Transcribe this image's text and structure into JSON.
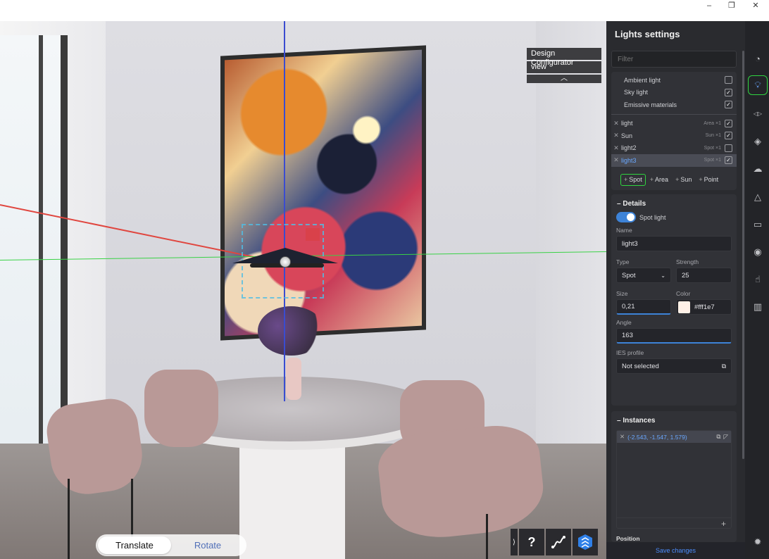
{
  "window": {
    "minimize": "–",
    "restore": "❐",
    "close": "✕"
  },
  "viewport": {
    "labels": [
      "Design Configurator",
      "view"
    ],
    "collapse": "︿",
    "mode": {
      "translate": "Translate",
      "rotate": "Rotate",
      "active": "translate"
    },
    "tools": {
      "expand": "⟩",
      "help": "?",
      "path": "path-icon",
      "logo": "logo-icon"
    }
  },
  "panel": {
    "title": "Lights settings",
    "filter_placeholder": "Filter",
    "env": [
      {
        "label": "Ambient light",
        "checked": false
      },
      {
        "label": "Sky light",
        "checked": true
      },
      {
        "label": "Emissive materials",
        "checked": true
      }
    ],
    "lights": [
      {
        "name": "light",
        "type": "Area ×1",
        "checked": true,
        "selected": false
      },
      {
        "name": "Sun",
        "type": "Sun ×1",
        "checked": true,
        "selected": false
      },
      {
        "name": "light2",
        "type": "Spot ×1",
        "checked": false,
        "selected": false
      },
      {
        "name": "light3",
        "type": "Spot ×1",
        "checked": true,
        "selected": true
      }
    ],
    "add": [
      "Spot",
      "Area",
      "Sun",
      "Point"
    ],
    "details": {
      "header": "Details",
      "spot_label": "Spot light",
      "name_label": "Name",
      "name": "light3",
      "type_label": "Type",
      "type": "Spot",
      "strength_label": "Strength",
      "strength": "25",
      "size_label": "Size",
      "size": "0,21",
      "color_label": "Color",
      "color": "#fff1e7",
      "angle_label": "Angle",
      "angle": "163",
      "ies_label": "IES profile",
      "ies": "Not selected"
    },
    "instances": {
      "header": "Instances",
      "item": "(-2.543, -1.547, 1.579)"
    },
    "position_label": "Position",
    "save": "Save changes"
  },
  "iconbar": [
    "timer-icon",
    "bulb-icon",
    "mirror-icon",
    "texture-icon",
    "cloud-icon",
    "pyramid-icon",
    "camera-icon",
    "eye-icon",
    "touch-icon",
    "map-icon",
    "settings-icon"
  ],
  "colors": {
    "accent": "#4c8eff",
    "highlight": "#30d440",
    "panel": "#2a2b2f"
  }
}
